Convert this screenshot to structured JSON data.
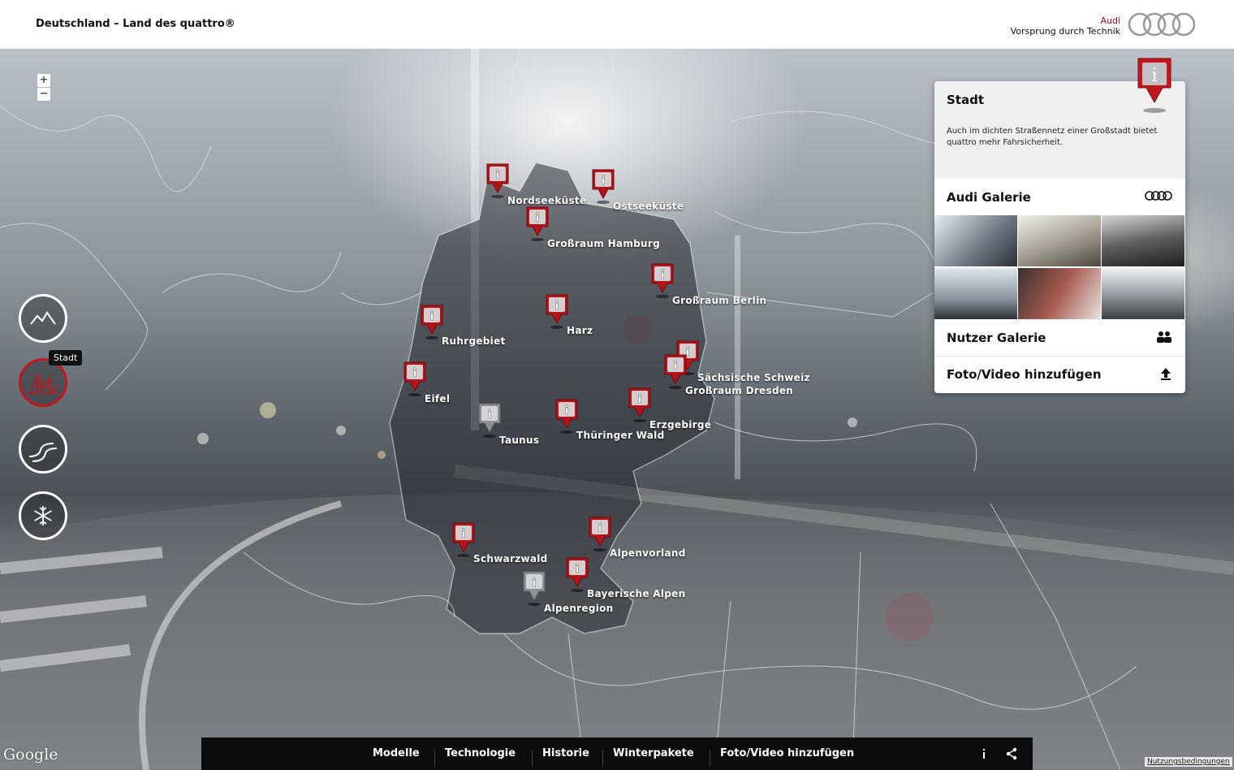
{
  "header": {
    "title": "Deutschland – Land des quattro®",
    "brand_name": "Audi",
    "slogan": "Vorsprung durch Technik"
  },
  "map": {
    "zoom_in": "+",
    "zoom_out": "−",
    "categories": [
      {
        "icon": "mountains-icon",
        "label": ""
      },
      {
        "icon": "city-skyline-icon",
        "label": "Stadt",
        "active": true
      },
      {
        "icon": "curvy-road-icon",
        "label": ""
      },
      {
        "icon": "snowflake-icon",
        "label": ""
      }
    ],
    "tooltip": "Stadt",
    "markers": [
      {
        "label": "Nordseeküste",
        "color": "red"
      },
      {
        "label": "Ostseeküste",
        "color": "red"
      },
      {
        "label": "Großraum Hamburg",
        "color": "red"
      },
      {
        "label": "Großraum Berlin",
        "color": "red"
      },
      {
        "label": "Ruhrgebiet",
        "color": "red"
      },
      {
        "label": "Harz",
        "color": "red"
      },
      {
        "label": "Sächsische Schweiz",
        "color": "red"
      },
      {
        "label": "Großraum Dresden",
        "color": "red"
      },
      {
        "label": "Eifel",
        "color": "red"
      },
      {
        "label": "Taunus",
        "color": "grey"
      },
      {
        "label": "Thüringer Wald",
        "color": "red"
      },
      {
        "label": "Erzgebirge",
        "color": "red"
      },
      {
        "label": "Schwarzwald",
        "color": "red"
      },
      {
        "label": "Alpenvorland",
        "color": "red"
      },
      {
        "label": "Bayerische Alpen",
        "color": "red"
      },
      {
        "label": "Alpenregion",
        "color": "grey"
      }
    ],
    "google_logo": "Google",
    "terms": "Nutzungsbedingungen"
  },
  "panel": {
    "title": "Stadt",
    "description": "Auch im dichten Straßennetz einer Großstadt bietet quattro mehr Fahrsicherheit.",
    "audi_gallery": "Audi Galerie",
    "user_gallery": "Nutzer Galerie",
    "add_media": "Foto/Video hinzufügen"
  },
  "footer": {
    "nav": [
      "Modelle",
      "Technologie",
      "Historie",
      "Winterpakete",
      "Foto/Video hinzufügen"
    ]
  },
  "colors": {
    "accent_red": "#c4161c",
    "brand_red": "#c0001a",
    "footer_bg": "#0c0c0c"
  }
}
